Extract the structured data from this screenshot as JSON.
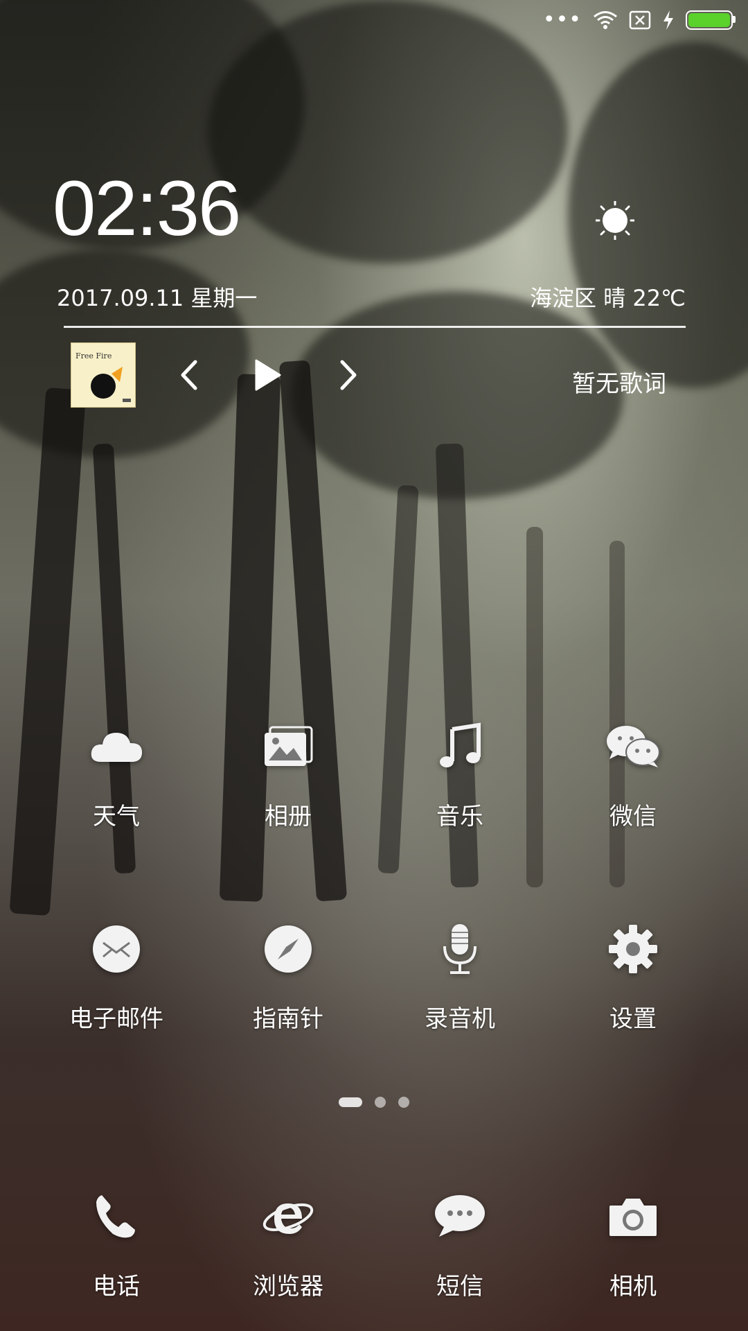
{
  "status_bar": {
    "signal_icon": "more-dots-icon",
    "wifi_icon": "wifi-icon",
    "sim_icon": "no-sim-icon",
    "charging_icon": "lightning-icon",
    "battery_level": 1.0,
    "battery_color": "#5bd12b"
  },
  "clock_widget": {
    "time": "02:36",
    "date": "2017.09.11 星期一",
    "weather": "海淀区 晴 22℃",
    "weather_icon": "sun-icon"
  },
  "music_widget": {
    "prev_icon": "chevron-left-icon",
    "play_icon": "play-icon",
    "next_icon": "chevron-right-icon",
    "lyrics": "暂无歌词",
    "album_art_text": "Free Fire"
  },
  "apps": [
    {
      "label": "天气",
      "icon": "cloud-icon"
    },
    {
      "label": "相册",
      "icon": "gallery-icon"
    },
    {
      "label": "音乐",
      "icon": "music-note-icon"
    },
    {
      "label": "微信",
      "icon": "wechat-icon"
    },
    {
      "label": "电子邮件",
      "icon": "mail-icon"
    },
    {
      "label": "指南针",
      "icon": "compass-icon"
    },
    {
      "label": "录音机",
      "icon": "microphone-icon"
    },
    {
      "label": "设置",
      "icon": "gear-icon"
    }
  ],
  "pager": {
    "pages": 3,
    "current": 1
  },
  "dock": [
    {
      "label": "电话",
      "icon": "phone-icon"
    },
    {
      "label": "浏览器",
      "icon": "browser-icon"
    },
    {
      "label": "短信",
      "icon": "message-icon"
    },
    {
      "label": "相机",
      "icon": "camera-icon"
    }
  ]
}
